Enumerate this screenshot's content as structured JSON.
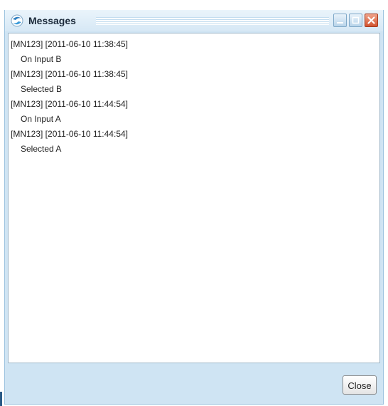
{
  "window": {
    "title": "Messages",
    "icon": "app-orb-icon",
    "controls": [
      "minimize-icon",
      "maximize-icon",
      "close-icon"
    ]
  },
  "messages": [
    {
      "header": "[MN123] [2011-06-10 11:38:45]",
      "text": "On Input B"
    },
    {
      "header": "[MN123] [2011-06-10 11:38:45]",
      "text": "Selected B"
    },
    {
      "header": "[MN123] [2011-06-10 11:44:54]",
      "text": "On Input A"
    },
    {
      "header": "[MN123] [2011-06-10 11:44:54]",
      "text": "Selected A"
    }
  ],
  "footer": {
    "close_label": "Close"
  },
  "colors": {
    "frame": "#cfe4f3",
    "title_text": "#1b2a3a",
    "close_control": "#d2532f"
  }
}
